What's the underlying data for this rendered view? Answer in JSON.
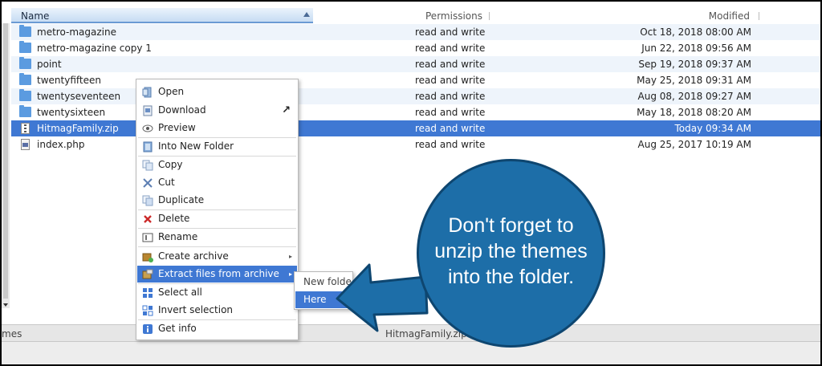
{
  "columns": {
    "name": "Name",
    "permissions": "Permissions",
    "modified": "Modified"
  },
  "files": [
    {
      "icon": "folder-icon",
      "name": "metro-magazine",
      "permissions": "read and write",
      "modified": "Oct 18, 2018 08:00 AM"
    },
    {
      "icon": "folder-icon",
      "name": "metro-magazine copy 1",
      "permissions": "read and write",
      "modified": "Jun 22, 2018 09:56 AM"
    },
    {
      "icon": "folder-icon",
      "name": "point",
      "permissions": "read and write",
      "modified": "Sep 19, 2018 09:37 AM"
    },
    {
      "icon": "folder-icon",
      "name": "twentyfifteen",
      "permissions": "read and write",
      "modified": "May 25, 2018 09:31 AM"
    },
    {
      "icon": "folder-icon",
      "name": "twentyseventeen",
      "permissions": "read and write",
      "modified": "Aug 08, 2018 09:27 AM"
    },
    {
      "icon": "folder-icon",
      "name": "twentysixteen",
      "permissions": "read and write",
      "modified": "May 18, 2018 08:20 AM"
    },
    {
      "icon": "zip-icon",
      "name": "HitmagFamily.zip",
      "permissions": "read and write",
      "modified": "Today 09:34 AM"
    },
    {
      "icon": "php-file-icon",
      "name": "index.php",
      "permissions": "read and write",
      "modified": "Aug 25, 2017 10:19 AM"
    }
  ],
  "context_menu": {
    "items": [
      {
        "label": "Open",
        "icon": "open-icon"
      },
      {
        "label": "Download",
        "icon": "download-icon"
      },
      {
        "label": "Preview",
        "icon": "eye-icon"
      },
      {
        "label": "Into New Folder",
        "icon": "new-folder-icon"
      },
      {
        "label": "Copy",
        "icon": "copy-icon"
      },
      {
        "label": "Cut",
        "icon": "scissors-icon"
      },
      {
        "label": "Duplicate",
        "icon": "duplicate-icon"
      },
      {
        "label": "Delete",
        "icon": "delete-x-icon"
      },
      {
        "label": "Rename",
        "icon": "rename-icon"
      },
      {
        "label": "Create archive",
        "icon": "archive-icon"
      },
      {
        "label": "Extract files from archive",
        "icon": "extract-icon"
      },
      {
        "label": "Select all",
        "icon": "select-all-icon"
      },
      {
        "label": "Invert selection",
        "icon": "invert-selection-icon"
      },
      {
        "label": "Get info",
        "icon": "info-icon"
      }
    ],
    "download_corner_glyph": "↗",
    "submenu_glyph": "▸"
  },
  "submenu": {
    "items": [
      "New folder",
      "Here"
    ]
  },
  "status": {
    "left": "mes",
    "center": "HitmagFamily.zip"
  },
  "callout": {
    "line1": "Don't forget to",
    "line2": "unzip the themes",
    "line3": "into the folder."
  },
  "colors": {
    "selection": "#3f78d3",
    "callout": "#1d6ea8",
    "folder": "#5b9be0"
  }
}
